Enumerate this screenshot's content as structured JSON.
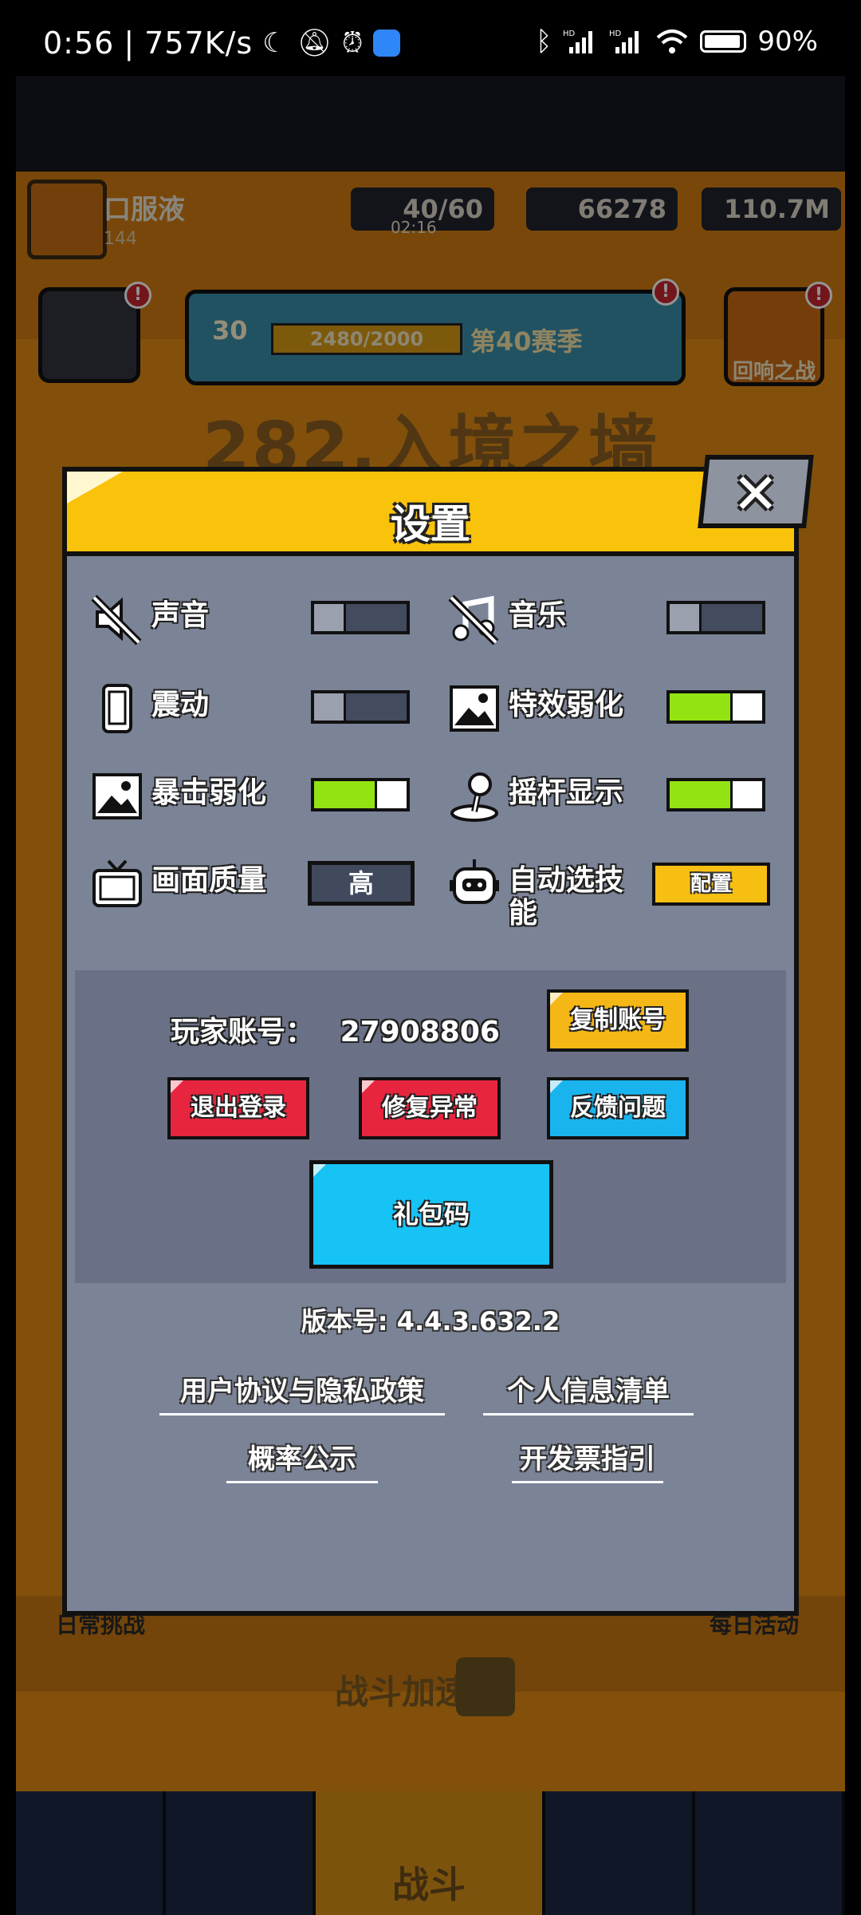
{
  "status_bar": {
    "time": "0:56",
    "network_speed": "757K/s",
    "battery": "90%",
    "icons": [
      "moon-icon",
      "mute-bell-icon",
      "alarm-icon",
      "app-icon",
      "bluetooth-icon",
      "signal-hd-icon",
      "signal-hd-icon",
      "wifi-icon",
      "battery-icon"
    ]
  },
  "background": {
    "player_name": "口服液",
    "player_level": "144",
    "energy": "40/60",
    "energy_timer": "02:16",
    "gems": "66278",
    "coins": "110.7M",
    "season_level": "30",
    "season_progress": "2480/2000",
    "season_name": "第40赛季",
    "echo_battle": "回响之战",
    "level_title": "282.入境之墙",
    "daily_challenge": "日常挑战",
    "daily_activity": "每日活动",
    "battle_speed": "战斗加速",
    "battle_tab": "战斗",
    "badge": "!"
  },
  "dialog": {
    "title": "设置",
    "close_label": "✕",
    "settings": {
      "sound": {
        "label": "声音",
        "state": "off"
      },
      "music": {
        "label": "音乐",
        "state": "off"
      },
      "vibration": {
        "label": "震动",
        "state": "off"
      },
      "effects_reduce": {
        "label": "特效弱化",
        "state": "on"
      },
      "crit_reduce": {
        "label": "暴击弱化",
        "state": "on"
      },
      "joystick_show": {
        "label": "摇杆显示",
        "state": "on"
      },
      "graphics_quality": {
        "label": "画面质量",
        "value": "高"
      },
      "auto_skill": {
        "label": "自动选技能",
        "button": "配置"
      }
    },
    "account": {
      "label": "玩家账号：",
      "id": "27908806",
      "copy_button": "复制账号",
      "logout_button": "退出登录",
      "repair_button": "修复异常",
      "feedback_button": "反馈问题",
      "gift_button": "礼包码"
    },
    "version": "版本号: 4.4.3.632.2",
    "links": {
      "agreement": "用户协议与隐私政策",
      "personal_info": "个人信息清单",
      "probability": "概率公示",
      "invoice": "开发票指引"
    }
  },
  "colors": {
    "dialog_bg": "#7b8396",
    "header_yellow": "#f9c20b",
    "toggle_on": "#93e312",
    "btn_red": "#e7253f",
    "btn_blue": "#19b4ee",
    "btn_yellow": "#f5b715"
  }
}
